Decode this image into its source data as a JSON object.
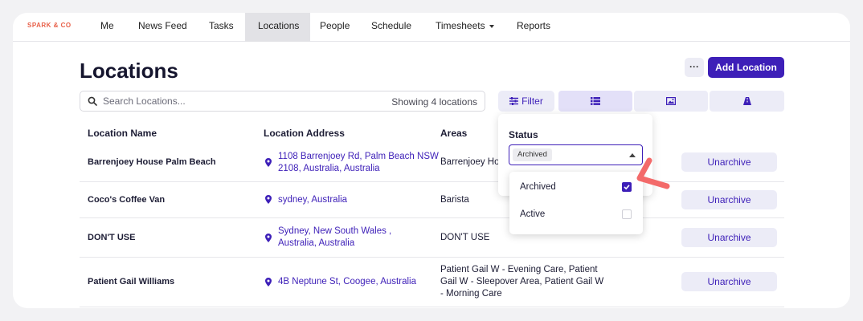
{
  "brand": "SPARK & CO",
  "nav": {
    "items": [
      "Me",
      "News Feed",
      "Tasks",
      "Locations",
      "People",
      "Schedule",
      "Timesheets",
      "Reports"
    ],
    "active": "Locations"
  },
  "page": {
    "title": "Locations",
    "more_label": "···",
    "add_label": "Add Location"
  },
  "search": {
    "placeholder": "Search Locations...",
    "count_text": "Showing 4 locations"
  },
  "filter": {
    "label": "Filter",
    "status_label": "Status",
    "selected_chip": "Archived",
    "options": [
      {
        "label": "Archived",
        "checked": true
      },
      {
        "label": "Active",
        "checked": false
      }
    ]
  },
  "view_icons": [
    "list-view-icon",
    "image-view-icon",
    "map-view-icon"
  ],
  "table": {
    "headers": {
      "name": "Location Name",
      "address": "Location Address",
      "areas": "Areas"
    },
    "rows": [
      {
        "name": "Barrenjoey House Palm Beach",
        "address": "1108 Barrenjoey Rd, Palm Beach NSW 2108, Australia, Australia",
        "areas": "Barrenjoey Ho",
        "action": "Unarchive"
      },
      {
        "name": "Coco's Coffee Van",
        "address": "sydney, Australia",
        "areas": "Barista",
        "action": "Unarchive"
      },
      {
        "name": "DON'T USE",
        "address": "Sydney, New South Wales , Australia, Australia",
        "areas": "DON'T USE",
        "action": "Unarchive"
      },
      {
        "name": "Patient Gail Williams",
        "address": "4B Neptune St, Coogee, Australia",
        "areas": "Patient Gail W - Evening Care, Patient Gail W - Sleepover Area, Patient Gail W - Morning Care",
        "action": "Unarchive"
      }
    ]
  },
  "colors": {
    "accent": "#3d1fb8",
    "brand": "#e8614a",
    "pointer": "#f36a6a"
  }
}
